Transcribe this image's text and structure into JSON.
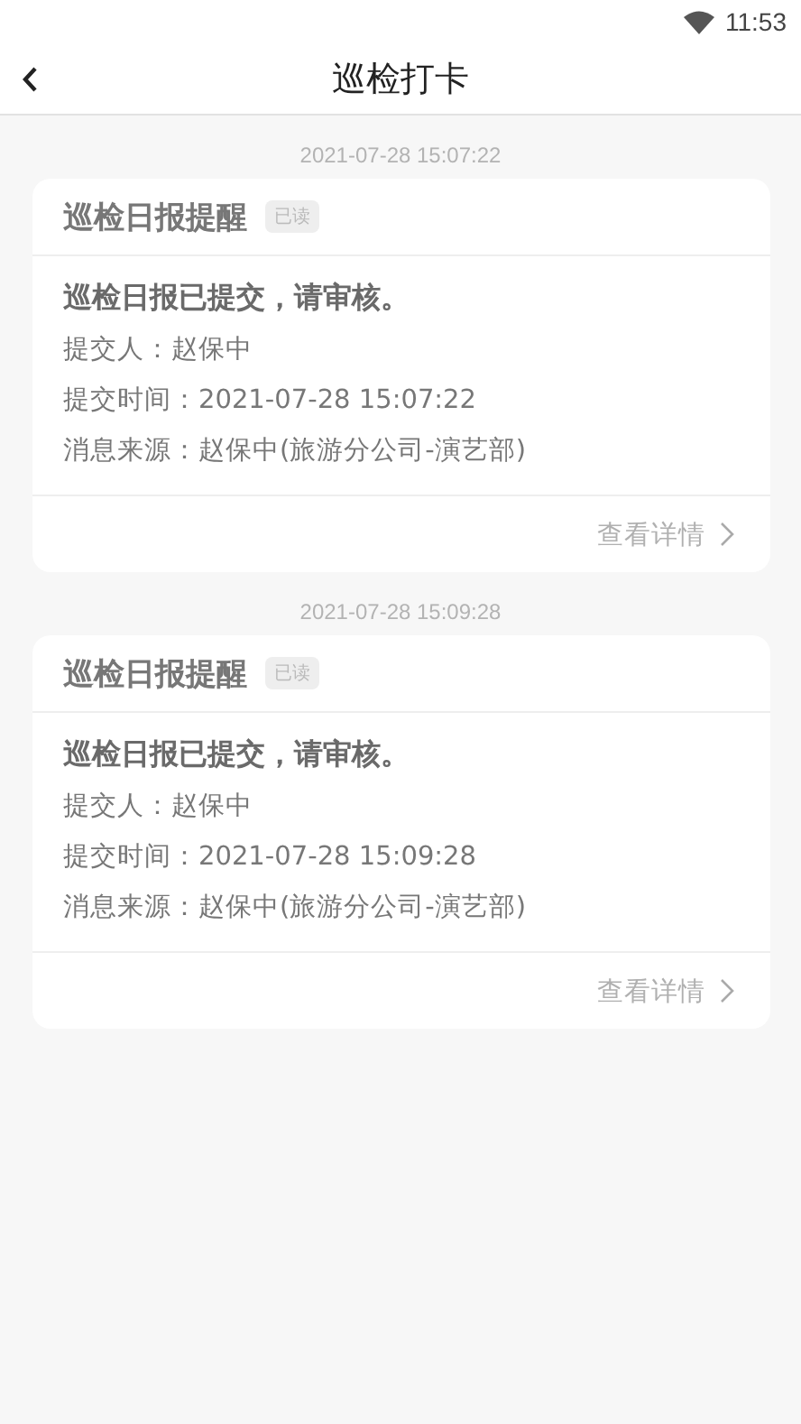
{
  "status_bar": {
    "time": "11:53"
  },
  "header": {
    "title": "巡检打卡"
  },
  "messages": [
    {
      "timestamp": "2021-07-28 15:07:22",
      "title": "巡检日报提醒",
      "badge": "已读",
      "headline": "巡检日报已提交，请审核。",
      "fields": [
        "提交人：赵保中",
        "提交时间：2021-07-28 15:07:22",
        "消息来源：赵保中(旅游分公司-演艺部)"
      ],
      "link": "查看详情"
    },
    {
      "timestamp": "2021-07-28 15:09:28",
      "title": "巡检日报提醒",
      "badge": "已读",
      "headline": "巡检日报已提交，请审核。",
      "fields": [
        "提交人：赵保中",
        "提交时间：2021-07-28 15:09:28",
        "消息来源：赵保中(旅游分公司-演艺部)"
      ],
      "link": "查看详情"
    }
  ]
}
